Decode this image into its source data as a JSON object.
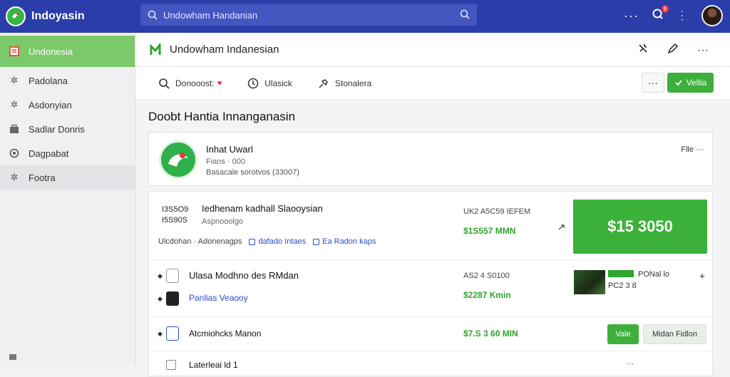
{
  "app": {
    "name": "Indoyasin"
  },
  "search": {
    "placeholder": "Undowham Handanian"
  },
  "sidebar": {
    "items": [
      {
        "label": "Undonesia",
        "icon": "document-icon",
        "active": true
      },
      {
        "label": "Padolana",
        "icon": "gear-icon"
      },
      {
        "label": "Asdonyian",
        "icon": "gear-icon"
      },
      {
        "label": "Sadlar Donris",
        "icon": "briefcase-icon"
      },
      {
        "label": "Dagpabat",
        "icon": "circle-icon"
      },
      {
        "label": "Footra",
        "icon": "gear-icon"
      }
    ]
  },
  "header": {
    "title": "Undowham Indanesian"
  },
  "toolbar": {
    "items": [
      {
        "label": "Donooost:",
        "icon": "search-icon"
      },
      {
        "label": "Ulasick",
        "icon": "clock-icon"
      },
      {
        "label": "Stonalera",
        "icon": "pin-icon"
      }
    ],
    "more_label": "···",
    "action_label": "Vellia"
  },
  "section": {
    "title": "Doobt Hantia Innanganasin"
  },
  "profile": {
    "name": "Inhat Uwarl",
    "sub": "Fians · 000",
    "detail": "Basacale sorotvos (33007)",
    "more": "Flle ···"
  },
  "rows": [
    {
      "code": "I3S5O9",
      "code2": "I5S90S",
      "title": "Iedhenam kadhall Slaooysian",
      "sub": "Aspnooolgo",
      "meta": "Ulcdohan · Adonenagps",
      "tag1": "dafado Intaes",
      "tag2": "Ea Radon kaps",
      "label": "UK2 A5C59 IEFEM",
      "amount": "$1S557 MMN",
      "total": "$15 3050"
    },
    {
      "title": "Ulasa Modhno des RMdan",
      "link": "Panlias Veaooy",
      "label": "AS2 4 S0100",
      "amount": "$2287 Kmin",
      "thumb_label": "PONal lo",
      "thumb_code": "PC2 3 8"
    },
    {
      "title": "Atcmiohcks Manon",
      "amount": "$7.S 3 60 MIN",
      "button": "Vale",
      "button2": "Midan Fidlon"
    },
    {
      "title": "Laterleai  ld 1"
    }
  ],
  "colors": {
    "topbar": "#2b3da8",
    "accent_green": "#3bb13a",
    "link_blue": "#2b4fc0"
  }
}
